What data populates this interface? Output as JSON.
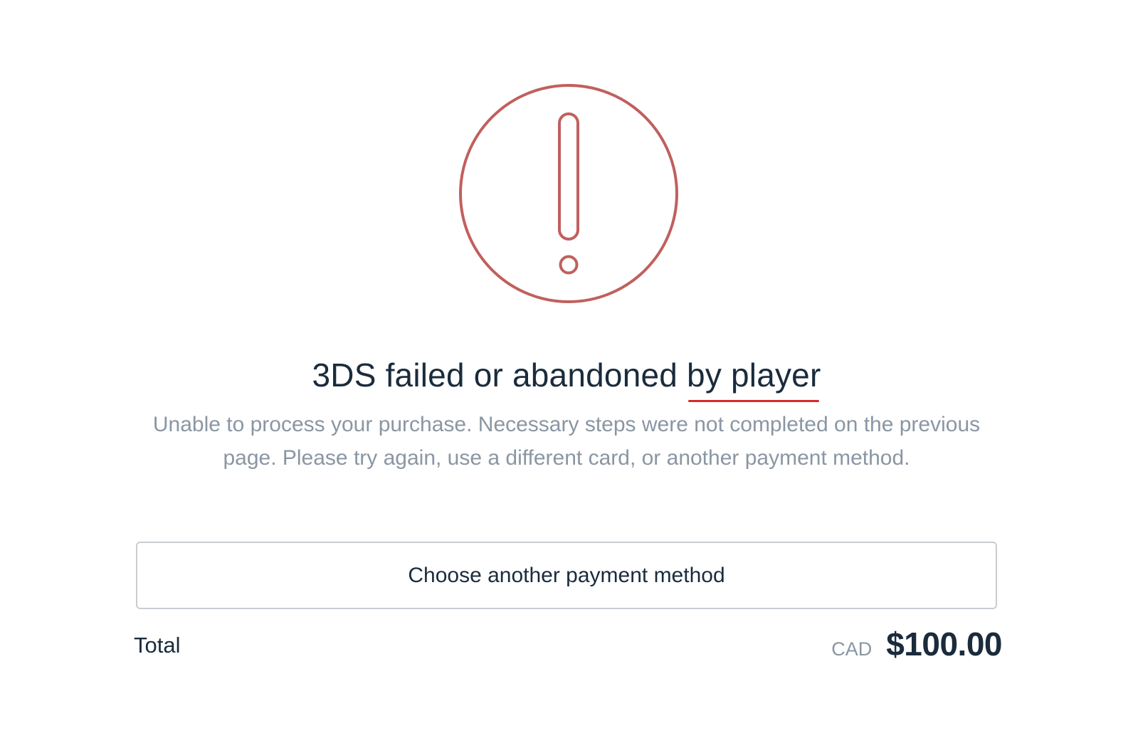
{
  "status": {
    "icon": "exclamation-circle-icon",
    "color": "#c0605e"
  },
  "heading": {
    "text_before": "3DS failed or abandoned ",
    "text_underlined": "by player"
  },
  "message": "Unable to process your purchase. Necessary steps were not completed on the previous page. Please try again, use a different card, or another payment method.",
  "actions": {
    "choose_another_label": "Choose another payment method"
  },
  "total": {
    "label": "Total",
    "currency": "CAD",
    "amount": "$100.00"
  }
}
